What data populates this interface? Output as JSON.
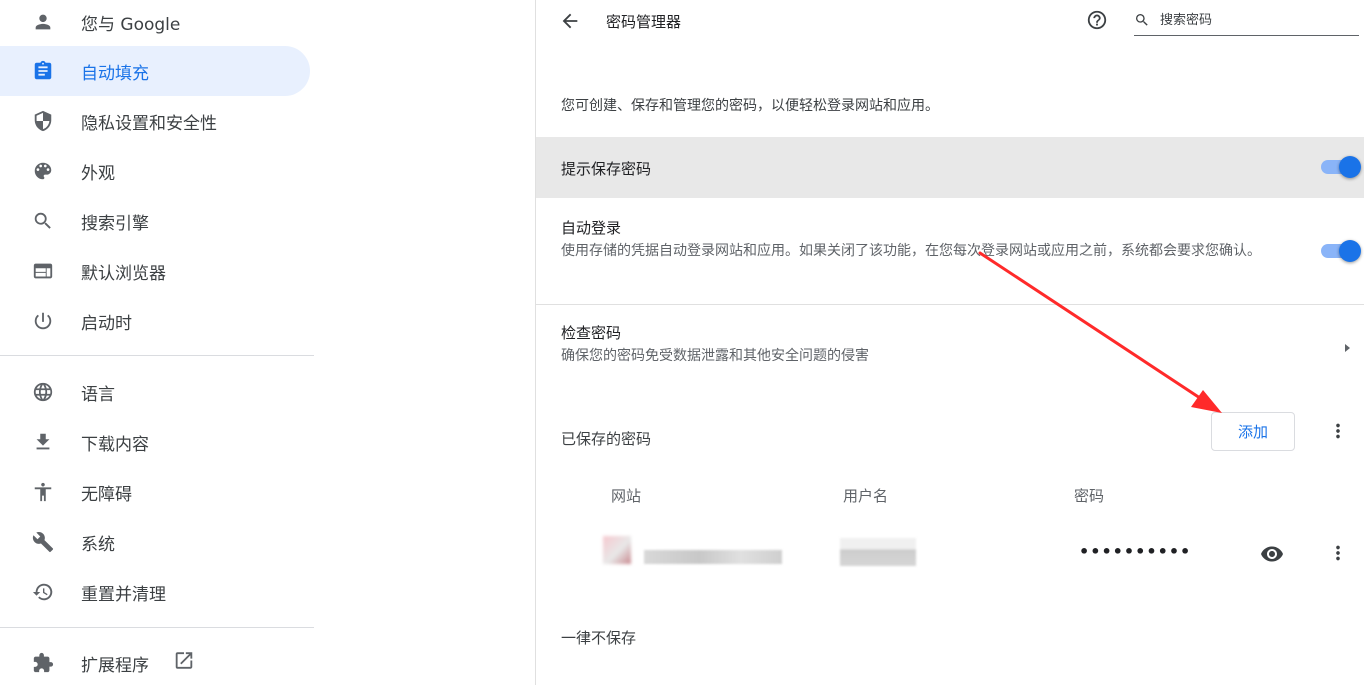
{
  "sidebar": {
    "items": [
      {
        "label": "您与 Google",
        "icon": "person-icon"
      },
      {
        "label": "自动填充",
        "icon": "clipboard-icon",
        "active": true
      },
      {
        "label": "隐私设置和安全性",
        "icon": "shield-icon"
      },
      {
        "label": "外观",
        "icon": "palette-icon"
      },
      {
        "label": "搜索引擎",
        "icon": "search-icon"
      },
      {
        "label": "默认浏览器",
        "icon": "browser-icon"
      },
      {
        "label": "启动时",
        "icon": "power-icon"
      },
      {
        "label": "语言",
        "icon": "globe-icon"
      },
      {
        "label": "下载内容",
        "icon": "download-icon"
      },
      {
        "label": "无障碍",
        "icon": "accessibility-icon"
      },
      {
        "label": "系统",
        "icon": "wrench-icon"
      },
      {
        "label": "重置并清理",
        "icon": "history-icon"
      },
      {
        "label": "扩展程序",
        "icon": "puzzle-icon"
      }
    ]
  },
  "header": {
    "title": "密码管理器",
    "search_placeholder": "搜索密码"
  },
  "main": {
    "description": "您可创建、保存和管理您的密码，以便轻松登录网站和应用。",
    "offer_save": {
      "label": "提示保存密码",
      "enabled": true
    },
    "auto_signin": {
      "label": "自动登录",
      "description": "使用存储的凭据自动登录网站和应用。如果关闭了该功能，在您每次登录网站或应用之前，系统都会要求您确认。",
      "enabled": true
    },
    "check_passwords": {
      "label": "检查密码",
      "description": "确保您的密码免受数据泄露和其他安全问题的侵害"
    },
    "saved_passwords": {
      "title": "已保存的密码",
      "add_label": "添加",
      "columns": [
        "网站",
        "用户名",
        "密码"
      ],
      "rows": [
        {
          "password": "••••••••••"
        }
      ]
    },
    "never_saved": {
      "title": "一律不保存"
    }
  },
  "colors": {
    "accent": "#1a73e8",
    "active_bg": "#e8f0fe",
    "annotation_arrow": "#ff2a2a"
  }
}
